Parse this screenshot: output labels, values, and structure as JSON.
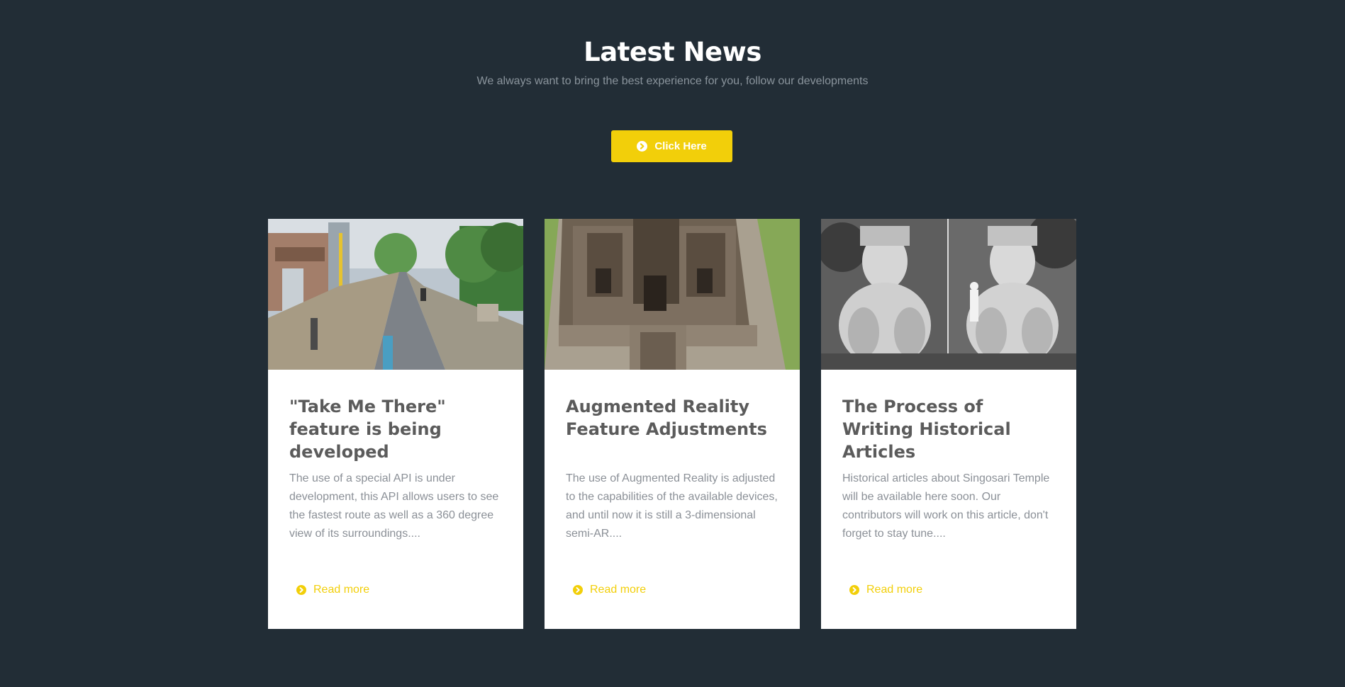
{
  "section": {
    "title": "Latest News",
    "subtitle": "We always want to bring the best experience for you, follow our developments",
    "cta_label": "Click Here",
    "cta_icon": "chevron-circle-right-icon"
  },
  "colors": {
    "background": "#222d36",
    "accent": "#f2cf0a",
    "card_background": "#ffffff",
    "title_text": "#5b5b5b",
    "body_text": "#8b9097"
  },
  "cards": [
    {
      "image": "street-view-photo",
      "title": "\"Take Me There\" feature is being developed",
      "excerpt": "The use of a special API is under development, this API allows users to see the fastest route as well as a 360 degree view of its surroundings....",
      "read_more": "Read more"
    },
    {
      "image": "temple-aerial-photo",
      "title": "Augmented Reality Feature Adjustments",
      "excerpt": "The use of Augmented Reality is adjusted to the capabilities of the available devices, and until now it is still a 3-dimensional semi-AR....",
      "read_more": "Read more"
    },
    {
      "image": "statue-historical-photo",
      "title": "The Process of Writing Historical Articles",
      "excerpt": "Historical articles about Singosari Temple will be available here soon. Our contributors will work on this article, don't forget to stay tune....",
      "read_more": "Read more"
    }
  ]
}
